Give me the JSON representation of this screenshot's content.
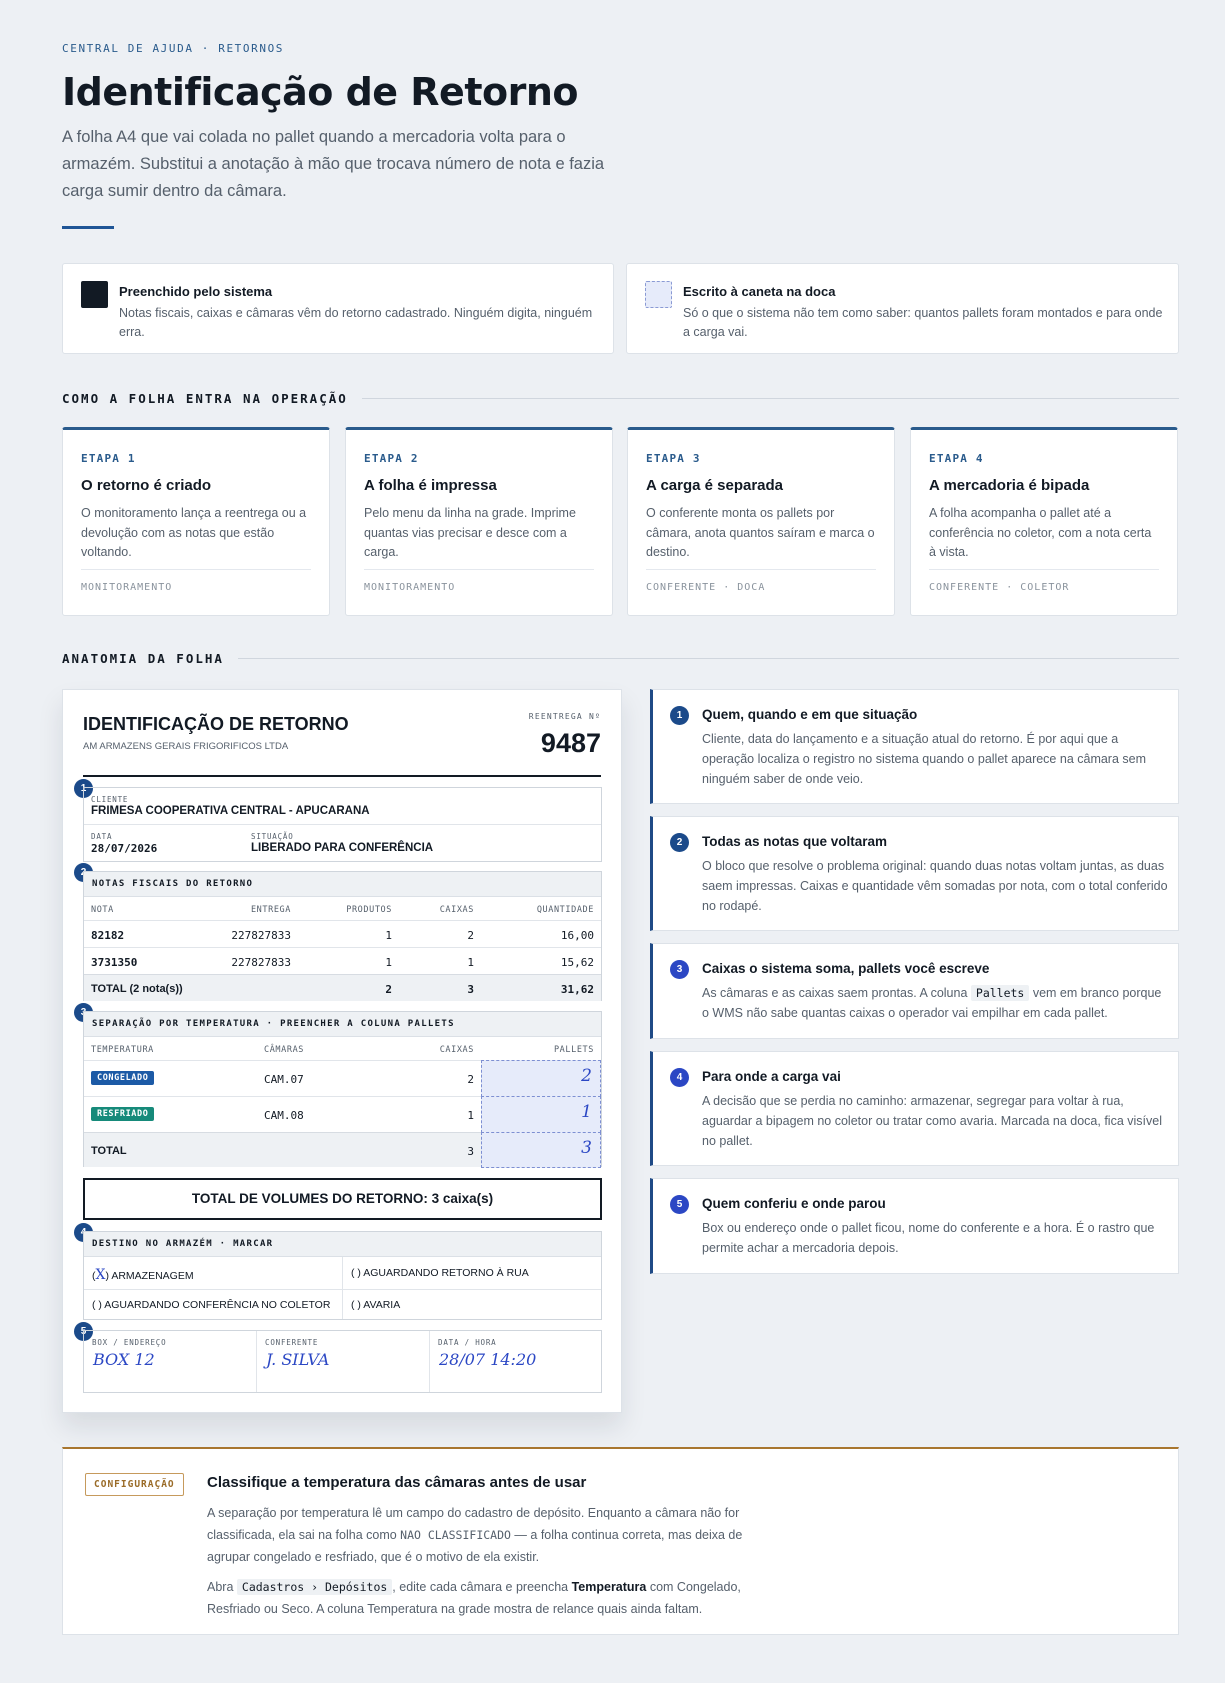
{
  "header": {
    "breadcrumb": "CENTRAL DE AJUDA · RETORNOS",
    "title": "Identificação de Retorno",
    "lead": "A folha A4 que vai colada no pallet quando a mercadoria volta para o armazém. Substitui a anotação à mão que trocava número de nota e fazia carga sumir dentro da câmara."
  },
  "legend": [
    {
      "title": "Preenchido pelo sistema",
      "desc": "Notas fiscais, caixas e câmaras vêm do retorno cadastrado. Ninguém digita, ninguém erra.",
      "color": "#121a24"
    },
    {
      "title": "Escrito à caneta na doca",
      "desc": "Só o que o sistema não tem como saber: quantos pallets foram montados e para onde a carga vai.",
      "color": "#e6ebfa"
    }
  ],
  "sections": {
    "flow": "COMO A FOLHA ENTRA NA OPERAÇÃO",
    "anatomy": "ANATOMIA DA FOLHA"
  },
  "stages": [
    {
      "tag": "ETAPA 1",
      "title": "O retorno é criado",
      "desc": "O monitoramento lança a reentrega ou a devolução com as notas que estão voltando.",
      "foot": "MONITORAMENTO"
    },
    {
      "tag": "ETAPA 2",
      "title": "A folha é impressa",
      "desc": "Pelo menu da linha na grade. Imprime quantas vias precisar e desce com a carga.",
      "foot": "MONITORAMENTO"
    },
    {
      "tag": "ETAPA 3",
      "title": "A carga é separada",
      "desc": "O conferente monta os pallets por câmara, anota quantos saíram e marca o destino.",
      "foot": "CONFERENTE · DOCA"
    },
    {
      "tag": "ETAPA 4",
      "title": "A mercadoria é bipada",
      "desc": "A folha acompanha o pallet até a conferência no coletor, com a nota certa à vista.",
      "foot": "CONFERENTE · COLETOR"
    }
  ],
  "sheet": {
    "title": "IDENTIFICAÇÃO DE RETORNO",
    "company": "AM ARMAZENS GERAIS FRIGORIFICOS LTDA",
    "reentrega_label": "REENTREGA Nº",
    "reentrega_num": "9487",
    "info": {
      "cliente_label": "CLIENTE",
      "cliente": "FRIMESA COOPERATIVA CENTRAL - APUCARANA",
      "data_label": "DATA",
      "data": "28/07/2026",
      "situacao_label": "SITUAÇÃO",
      "situacao": "LIBERADO PARA CONFERÊNCIA"
    },
    "notas": {
      "header": "NOTAS FISCAIS DO RETORNO",
      "columns": [
        "NOTA",
        "ENTREGA",
        "PRODUTOS",
        "CAIXAS",
        "QUANTIDADE"
      ],
      "rows": [
        [
          "82182",
          "227827833",
          "1",
          "2",
          "16,00"
        ],
        [
          "3731350",
          "227827833",
          "1",
          "1",
          "15,62"
        ]
      ],
      "total": [
        "TOTAL (2 nota(s))",
        "",
        "2",
        "3",
        "31,62"
      ]
    },
    "separacao": {
      "header": "SEPARAÇÃO POR TEMPERATURA  ·  PREENCHER A COLUNA PALLETS",
      "columns": [
        "TEMPERATURA",
        "CÂMARAS",
        "CAIXAS",
        "PALLETS"
      ],
      "rows": [
        {
          "temp": "CONGELADO",
          "color": "#1c5aa6",
          "camara": "CAM.07",
          "caixas": "2",
          "pallets": "2"
        },
        {
          "temp": "RESFRIADO",
          "color": "#168a7a",
          "camara": "CAM.08",
          "caixas": "1",
          "pallets": "1"
        }
      ],
      "total_label": "TOTAL",
      "total_caixas": "3",
      "total_pallets": "3"
    },
    "total_volumes": "TOTAL DE VOLUMES DO RETORNO: 3 caixa(s)",
    "destino": {
      "header": "DESTINO NO ARMAZÉM  ·  MARCAR",
      "options": [
        {
          "mark": "X",
          "label": "ARMAZENAGEM"
        },
        {
          "mark": "",
          "label": "AGUARDANDO RETORNO À RUA"
        },
        {
          "mark": "",
          "label": "AGUARDANDO CONFERÊNCIA NO COLETOR"
        },
        {
          "mark": "",
          "label": "AVARIA"
        }
      ]
    },
    "rodape": [
      {
        "label": "BOX / ENDEREÇO",
        "value": "BOX 12"
      },
      {
        "label": "CONFERENTE",
        "value": "J. SILVA"
      },
      {
        "label": "DATA / HORA",
        "value": "28/07 14:20"
      }
    ],
    "badges": [
      "1",
      "2",
      "3",
      "4",
      "5"
    ]
  },
  "explanations": [
    {
      "num": "1",
      "title": "Quem, quando e em que situação",
      "desc": "Cliente, data do lançamento e a situação atual do retorno. É por aqui que a operação localiza o registro no sistema quando o pallet aparece na câmara sem ninguém saber de onde veio."
    },
    {
      "num": "2",
      "title": "Todas as notas que voltaram",
      "desc": "O bloco que resolve o problema original: quando duas notas voltam juntas, as duas saem impressas. Caixas e quantidade vêm somadas por nota, com o total conferido no rodapé."
    },
    {
      "num": "3",
      "title": "Caixas o sistema soma, pallets você escreve",
      "desc_a": "As câmaras e as caixas saem prontas. A coluna ",
      "code": "Pallets",
      "desc_b": " vem em branco porque o WMS não sabe quantas caixas o operador vai empilhar em cada pallet."
    },
    {
      "num": "4",
      "title": "Para onde a carga vai",
      "desc": "A decisão que se perdia no caminho: armazenar, segregar para voltar à rua, aguardar a bipagem no coletor ou tratar como avaria. Marcada na doca, fica visível no pallet."
    },
    {
      "num": "5",
      "title": "Quem conferiu e onde parou",
      "desc": "Box ou endereço onde o pallet ficou, nome do conferente e a hora. É o rastro que permite achar a mercadoria depois."
    }
  ],
  "config": {
    "tag": "CONFIGURAÇÃO",
    "title": "Classifique a temperatura das câmaras antes de usar",
    "p1_a": "A separação por temperatura lê um campo do cadastro de depósito. Enquanto a câmara não for classificada, ela sai na folha como ",
    "p1_code": "NAO CLASSIFICADO",
    "p1_b": " — a folha continua correta, mas deixa de agrupar congelado e resfriado, que é o motivo de ela existir.",
    "p2_a": "Abra ",
    "p2_code": "Cadastros › Depósitos",
    "p2_b": ", edite cada câmara e preencha ",
    "p2_bold": "Temperatura",
    "p2_c": " com Congelado, Resfriado ou Seco. A coluna Temperatura na grade mostra de relance quais ainda faltam."
  }
}
